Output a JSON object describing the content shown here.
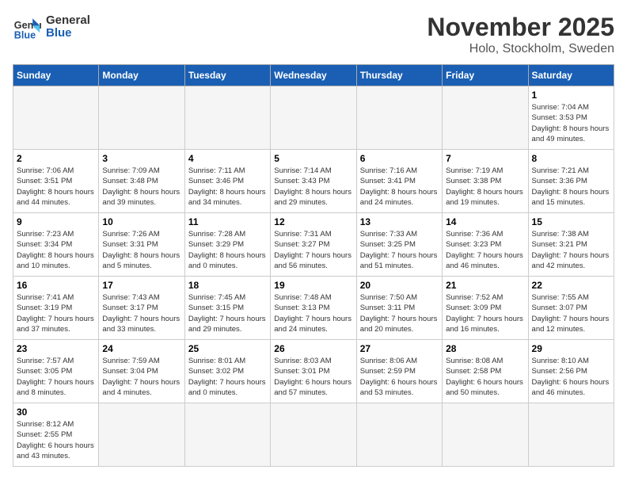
{
  "logo": {
    "line1": "General",
    "line2": "Blue"
  },
  "title": "November 2025",
  "subtitle": "Holo, Stockholm, Sweden",
  "weekdays": [
    "Sunday",
    "Monday",
    "Tuesday",
    "Wednesday",
    "Thursday",
    "Friday",
    "Saturday"
  ],
  "days": [
    {
      "date": null
    },
    {
      "date": null
    },
    {
      "date": null
    },
    {
      "date": null
    },
    {
      "date": null
    },
    {
      "date": null
    },
    {
      "date": 1,
      "sunrise": "7:04 AM",
      "sunset": "3:53 PM",
      "daylight": "8 hours and 49 minutes."
    },
    {
      "date": 2,
      "sunrise": "7:06 AM",
      "sunset": "3:51 PM",
      "daylight": "8 hours and 44 minutes."
    },
    {
      "date": 3,
      "sunrise": "7:09 AM",
      "sunset": "3:48 PM",
      "daylight": "8 hours and 39 minutes."
    },
    {
      "date": 4,
      "sunrise": "7:11 AM",
      "sunset": "3:46 PM",
      "daylight": "8 hours and 34 minutes."
    },
    {
      "date": 5,
      "sunrise": "7:14 AM",
      "sunset": "3:43 PM",
      "daylight": "8 hours and 29 minutes."
    },
    {
      "date": 6,
      "sunrise": "7:16 AM",
      "sunset": "3:41 PM",
      "daylight": "8 hours and 24 minutes."
    },
    {
      "date": 7,
      "sunrise": "7:19 AM",
      "sunset": "3:38 PM",
      "daylight": "8 hours and 19 minutes."
    },
    {
      "date": 8,
      "sunrise": "7:21 AM",
      "sunset": "3:36 PM",
      "daylight": "8 hours and 15 minutes."
    },
    {
      "date": 9,
      "sunrise": "7:23 AM",
      "sunset": "3:34 PM",
      "daylight": "8 hours and 10 minutes."
    },
    {
      "date": 10,
      "sunrise": "7:26 AM",
      "sunset": "3:31 PM",
      "daylight": "8 hours and 5 minutes."
    },
    {
      "date": 11,
      "sunrise": "7:28 AM",
      "sunset": "3:29 PM",
      "daylight": "8 hours and 0 minutes."
    },
    {
      "date": 12,
      "sunrise": "7:31 AM",
      "sunset": "3:27 PM",
      "daylight": "7 hours and 56 minutes."
    },
    {
      "date": 13,
      "sunrise": "7:33 AM",
      "sunset": "3:25 PM",
      "daylight": "7 hours and 51 minutes."
    },
    {
      "date": 14,
      "sunrise": "7:36 AM",
      "sunset": "3:23 PM",
      "daylight": "7 hours and 46 minutes."
    },
    {
      "date": 15,
      "sunrise": "7:38 AM",
      "sunset": "3:21 PM",
      "daylight": "7 hours and 42 minutes."
    },
    {
      "date": 16,
      "sunrise": "7:41 AM",
      "sunset": "3:19 PM",
      "daylight": "7 hours and 37 minutes."
    },
    {
      "date": 17,
      "sunrise": "7:43 AM",
      "sunset": "3:17 PM",
      "daylight": "7 hours and 33 minutes."
    },
    {
      "date": 18,
      "sunrise": "7:45 AM",
      "sunset": "3:15 PM",
      "daylight": "7 hours and 29 minutes."
    },
    {
      "date": 19,
      "sunrise": "7:48 AM",
      "sunset": "3:13 PM",
      "daylight": "7 hours and 24 minutes."
    },
    {
      "date": 20,
      "sunrise": "7:50 AM",
      "sunset": "3:11 PM",
      "daylight": "7 hours and 20 minutes."
    },
    {
      "date": 21,
      "sunrise": "7:52 AM",
      "sunset": "3:09 PM",
      "daylight": "7 hours and 16 minutes."
    },
    {
      "date": 22,
      "sunrise": "7:55 AM",
      "sunset": "3:07 PM",
      "daylight": "7 hours and 12 minutes."
    },
    {
      "date": 23,
      "sunrise": "7:57 AM",
      "sunset": "3:05 PM",
      "daylight": "7 hours and 8 minutes."
    },
    {
      "date": 24,
      "sunrise": "7:59 AM",
      "sunset": "3:04 PM",
      "daylight": "7 hours and 4 minutes."
    },
    {
      "date": 25,
      "sunrise": "8:01 AM",
      "sunset": "3:02 PM",
      "daylight": "7 hours and 0 minutes."
    },
    {
      "date": 26,
      "sunrise": "8:03 AM",
      "sunset": "3:01 PM",
      "daylight": "6 hours and 57 minutes."
    },
    {
      "date": 27,
      "sunrise": "8:06 AM",
      "sunset": "2:59 PM",
      "daylight": "6 hours and 53 minutes."
    },
    {
      "date": 28,
      "sunrise": "8:08 AM",
      "sunset": "2:58 PM",
      "daylight": "6 hours and 50 minutes."
    },
    {
      "date": 29,
      "sunrise": "8:10 AM",
      "sunset": "2:56 PM",
      "daylight": "6 hours and 46 minutes."
    },
    {
      "date": 30,
      "sunrise": "8:12 AM",
      "sunset": "2:55 PM",
      "daylight": "6 hours and 43 minutes."
    }
  ]
}
